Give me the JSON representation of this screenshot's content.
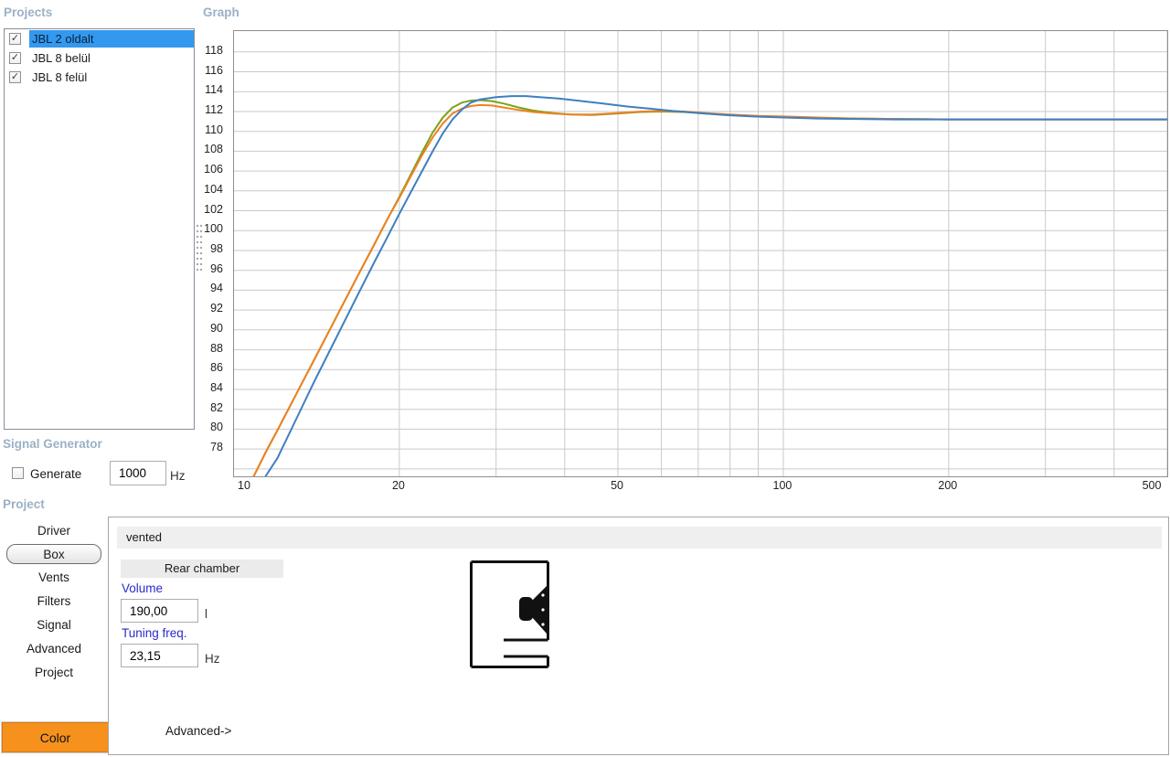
{
  "projects_panel": {
    "title": "Projects",
    "items": [
      {
        "label": "JBL 2 oldalt",
        "checked": true,
        "selected": true
      },
      {
        "label": "JBL 8 belül",
        "checked": true,
        "selected": false
      },
      {
        "label": "JBL 8 felül",
        "checked": true,
        "selected": false
      }
    ]
  },
  "graph_panel": {
    "title": "Graph"
  },
  "signal_generator": {
    "title": "Signal Generator",
    "generate_label": "Generate",
    "generate_checked": false,
    "frequency_value": "1000",
    "frequency_unit": "Hz"
  },
  "project_panel": {
    "title": "Project",
    "tabs": [
      {
        "label": "Driver",
        "selected": false
      },
      {
        "label": "Box",
        "selected": true
      },
      {
        "label": "Vents",
        "selected": false
      },
      {
        "label": "Filters",
        "selected": false
      },
      {
        "label": "Signal",
        "selected": false
      },
      {
        "label": "Advanced",
        "selected": false
      },
      {
        "label": "Project",
        "selected": false
      }
    ],
    "color_button_label": "Color"
  },
  "box_panel": {
    "type_header": "vented",
    "chamber_label": "Rear chamber",
    "volume_label": "Volume",
    "volume_value": "190,00",
    "volume_unit": "l",
    "tuning_label": "Tuning freq.",
    "tuning_value": "23,15",
    "tuning_unit": "Hz",
    "advanced_label": "Advanced->",
    "diagram": "vented-box-with-driver-and-port"
  },
  "icons": {
    "check": "✓"
  },
  "colors": {
    "section_title": "#9bb1c5",
    "selection_blue": "#3399ee",
    "field_label_blue": "#2a2ace",
    "color_button_orange": "#f6911e",
    "grid": "#c9c9c9",
    "series_blue": "#3e7fc1",
    "series_orange": "#ef8122",
    "series_green": "#7aa21b"
  },
  "chart_data": {
    "type": "line",
    "x_scale": "log",
    "xlim": [
      10,
      500
    ],
    "ylim": [
      75.25,
      120.1
    ],
    "x_ticks": [
      10,
      20,
      50,
      100,
      200,
      500
    ],
    "y_ticks": [
      78,
      80,
      82,
      84,
      86,
      88,
      90,
      92,
      94,
      96,
      98,
      100,
      102,
      104,
      106,
      108,
      110,
      112,
      114,
      116,
      118
    ],
    "grid_x": [
      20,
      30,
      40,
      50,
      60,
      70,
      80,
      90,
      100,
      200,
      300,
      400,
      500
    ],
    "grid_y": [
      76,
      78,
      80,
      82,
      84,
      86,
      88,
      90,
      92,
      94,
      96,
      98,
      100,
      102,
      104,
      106,
      108,
      110,
      112,
      114,
      116,
      118
    ],
    "grid_on": true,
    "legend": "none",
    "ylabel": "",
    "xlabel": "",
    "series": [
      {
        "name": "JBL 8 felül",
        "color": "#7aa21b",
        "points": [
          [
            10.85,
            75.2
          ],
          [
            11.5,
            78.0
          ],
          [
            12,
            79.9
          ],
          [
            13,
            83.6
          ],
          [
            14,
            87.0
          ],
          [
            15,
            90.2
          ],
          [
            16,
            93.2
          ],
          [
            17,
            96.0
          ],
          [
            18,
            98.6
          ],
          [
            19,
            101.1
          ],
          [
            20,
            103.4
          ],
          [
            21,
            105.7
          ],
          [
            22,
            107.9
          ],
          [
            23,
            109.9
          ],
          [
            24,
            111.4
          ],
          [
            25,
            112.4
          ],
          [
            26,
            112.9
          ],
          [
            27,
            113.1
          ],
          [
            28,
            113.15
          ],
          [
            29.5,
            113.05
          ],
          [
            31,
            112.8
          ],
          [
            33,
            112.4
          ],
          [
            35,
            112.1
          ],
          [
            38,
            111.85
          ],
          [
            41,
            111.7
          ],
          [
            45,
            111.65
          ],
          [
            50,
            111.8
          ],
          [
            55,
            111.95
          ],
          [
            60,
            112.0
          ],
          [
            66,
            111.95
          ],
          [
            72,
            111.8
          ],
          [
            80,
            111.65
          ],
          [
            90,
            111.5
          ],
          [
            100,
            111.45
          ],
          [
            115,
            111.35
          ],
          [
            135,
            111.3
          ],
          [
            160,
            111.25
          ],
          [
            200,
            111.2
          ],
          [
            300,
            111.2
          ],
          [
            500,
            111.2
          ]
        ]
      },
      {
        "name": "JBL 8 belül",
        "color": "#ef8122",
        "points": [
          [
            10.85,
            75.2
          ],
          [
            11.5,
            78.0
          ],
          [
            12,
            79.9
          ],
          [
            13,
            83.6
          ],
          [
            14,
            87.0
          ],
          [
            15,
            90.2
          ],
          [
            16,
            93.2
          ],
          [
            17,
            96.0
          ],
          [
            18,
            98.6
          ],
          [
            19,
            101.1
          ],
          [
            20,
            103.3
          ],
          [
            21,
            105.5
          ],
          [
            22,
            107.6
          ],
          [
            23,
            109.4
          ],
          [
            24,
            110.8
          ],
          [
            25,
            111.8
          ],
          [
            26,
            112.3
          ],
          [
            27,
            112.55
          ],
          [
            28,
            112.65
          ],
          [
            29.5,
            112.6
          ],
          [
            31,
            112.4
          ],
          [
            33,
            112.15
          ],
          [
            35,
            111.95
          ],
          [
            38,
            111.8
          ],
          [
            41,
            111.7
          ],
          [
            45,
            111.7
          ],
          [
            50,
            111.85
          ],
          [
            55,
            112.0
          ],
          [
            60,
            112.05
          ],
          [
            66,
            112.0
          ],
          [
            72,
            111.85
          ],
          [
            80,
            111.7
          ],
          [
            90,
            111.55
          ],
          [
            100,
            111.5
          ],
          [
            115,
            111.4
          ],
          [
            135,
            111.3
          ],
          [
            160,
            111.25
          ],
          [
            200,
            111.2
          ],
          [
            300,
            111.2
          ],
          [
            500,
            111.2
          ]
        ]
      },
      {
        "name": "JBL 2 oldalt",
        "color": "#3e7fc1",
        "points": [
          [
            11.4,
            75.2
          ],
          [
            12,
            77.1
          ],
          [
            13,
            81.1
          ],
          [
            14,
            84.8
          ],
          [
            15,
            88.1
          ],
          [
            16,
            91.2
          ],
          [
            17,
            94.1
          ],
          [
            18,
            96.8
          ],
          [
            19,
            99.3
          ],
          [
            20,
            101.7
          ],
          [
            21,
            103.9
          ],
          [
            22,
            106.0
          ],
          [
            23,
            108.0
          ],
          [
            24,
            109.8
          ],
          [
            25,
            111.2
          ],
          [
            26,
            112.2
          ],
          [
            27,
            112.9
          ],
          [
            28,
            113.2
          ],
          [
            30,
            113.45
          ],
          [
            32,
            113.55
          ],
          [
            34,
            113.55
          ],
          [
            36,
            113.45
          ],
          [
            39,
            113.3
          ],
          [
            43,
            113.05
          ],
          [
            47,
            112.8
          ],
          [
            52,
            112.5
          ],
          [
            57,
            112.3
          ],
          [
            63,
            112.05
          ],
          [
            70,
            111.85
          ],
          [
            78,
            111.65
          ],
          [
            88,
            111.5
          ],
          [
            100,
            111.4
          ],
          [
            115,
            111.3
          ],
          [
            135,
            111.25
          ],
          [
            160,
            111.2
          ],
          [
            200,
            111.2
          ],
          [
            300,
            111.2
          ],
          [
            500,
            111.2
          ]
        ]
      }
    ]
  }
}
